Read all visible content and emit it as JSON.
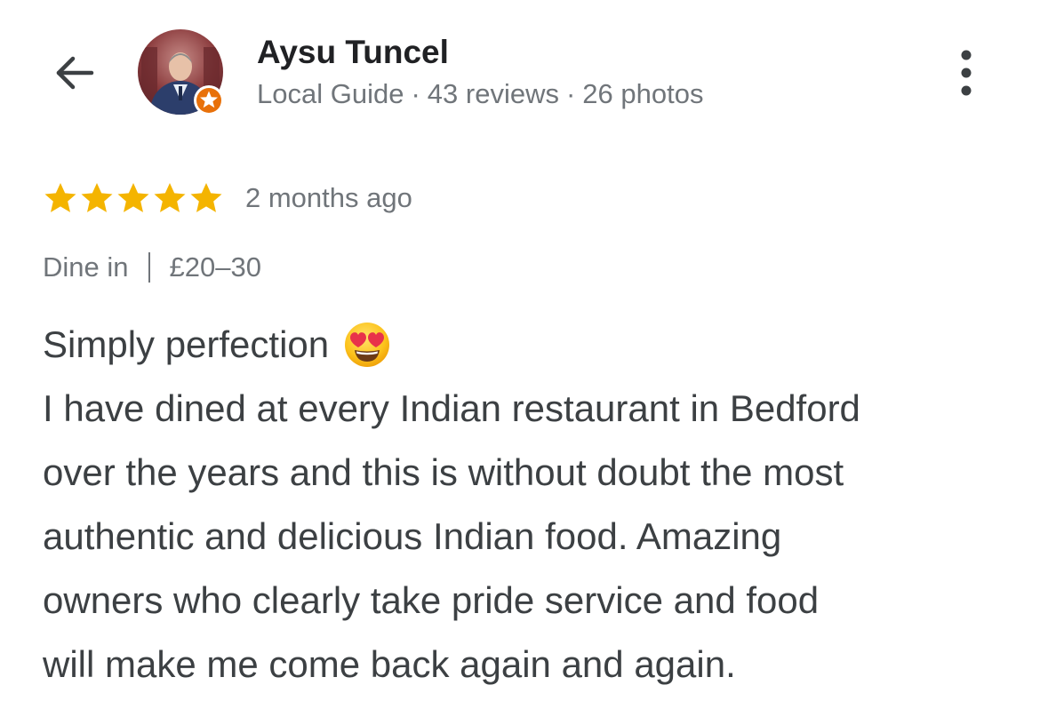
{
  "header": {
    "back_icon": "arrow-back-icon",
    "more_icon": "more-vertical-icon",
    "user": {
      "name": "Aysu Tuncel",
      "level": "Local Guide",
      "separator": "·",
      "reviews": "43 reviews",
      "photos": "26 photos",
      "avatar_icon": "user-avatar",
      "badge_icon": "local-guide-star-badge-icon"
    }
  },
  "review": {
    "rating": 5,
    "rating_max": 5,
    "star_color": "#f4b400",
    "time": "2 months ago",
    "service": "Dine in",
    "separator": "|",
    "price": "£20–30",
    "title": "Simply perfection",
    "title_emoji_icon": "heart-eyes-emoji-icon",
    "lines": [
      "I have dined at every Indian restaurant in Bedford",
      "over the years and this is without doubt the most",
      "authentic and delicious Indian food. Amazing",
      "owners who clearly take pride service and food",
      "will make me come back again and again."
    ]
  },
  "colors": {
    "primary_text": "#202124",
    "secondary_text": "#70757a",
    "body_text": "#3c4043",
    "badge_orange": "#e8710a"
  }
}
